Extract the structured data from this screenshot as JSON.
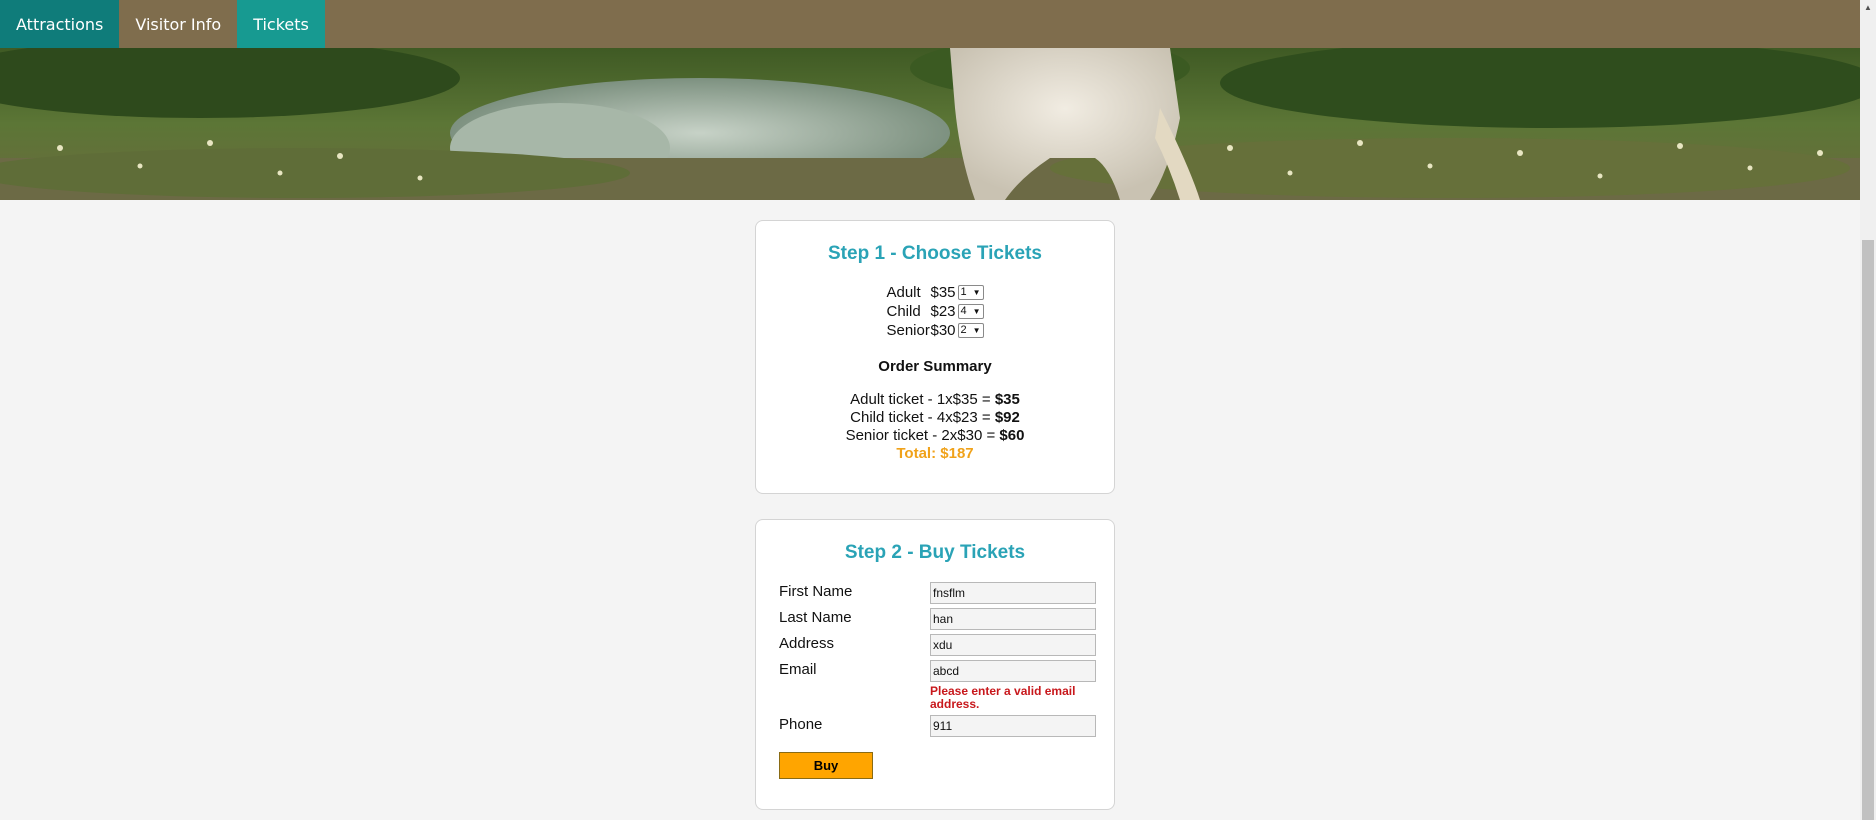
{
  "nav": {
    "tabs": [
      {
        "label": "Attractions"
      },
      {
        "label": "Visitor Info"
      },
      {
        "label": "Tickets"
      }
    ]
  },
  "colors": {
    "nav_bg": "#7f6d4d",
    "nav_teal": "#0f7c7a",
    "heading": "#2aa3b6",
    "total": "#f0a21a",
    "error": "#c8181c",
    "buy_button": "#ffa500"
  },
  "step1": {
    "title": "Step 1 - Choose Tickets",
    "tickets": [
      {
        "label": "Adult",
        "price": "$35",
        "qty": "1"
      },
      {
        "label": "Child",
        "price": "$23",
        "qty": "4"
      },
      {
        "label": "Senior",
        "price": "$30",
        "qty": "2"
      }
    ],
    "summary_title": "Order Summary",
    "summary": [
      {
        "text": "Adult ticket - 1x$35 = ",
        "amount": "$35"
      },
      {
        "text": "Child ticket - 4x$23 = ",
        "amount": "$92"
      },
      {
        "text": "Senior ticket - 2x$30 = ",
        "amount": "$60"
      }
    ],
    "total": "Total: $187"
  },
  "step2": {
    "title": "Step 2 - Buy Tickets",
    "fields": {
      "first_name": {
        "label": "First Name",
        "value": "fnsflm"
      },
      "last_name": {
        "label": "Last Name",
        "value": "han"
      },
      "address": {
        "label": "Address",
        "value": "xdu"
      },
      "email": {
        "label": "Email",
        "value": "abcd",
        "error": "Please enter a valid email address."
      },
      "phone": {
        "label": "Phone",
        "value": "911"
      }
    },
    "buy_label": "Buy"
  }
}
